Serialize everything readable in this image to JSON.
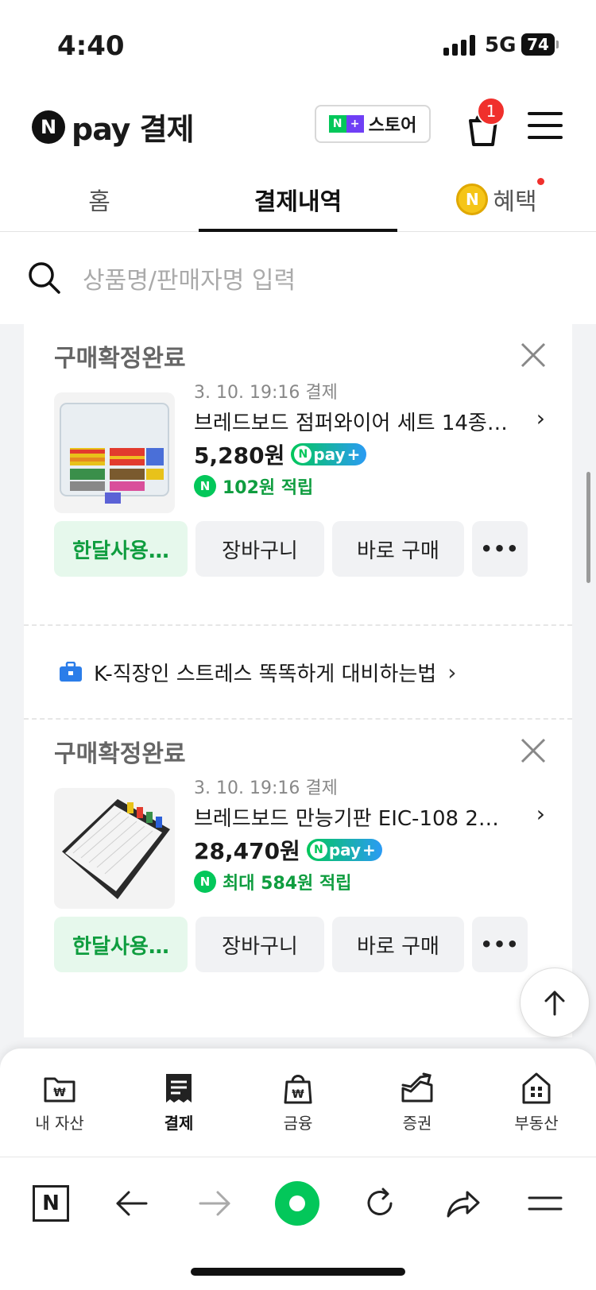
{
  "status_bar": {
    "time": "4:40",
    "network": "5G",
    "battery": "74"
  },
  "header": {
    "logo_letter": "N",
    "brand": "pay 결제",
    "store_button": {
      "np_left": "N",
      "np_right": "+",
      "label": "스토어"
    },
    "cart_badge": "1"
  },
  "tabs": [
    {
      "label": "홈"
    },
    {
      "label": "결제내역"
    },
    {
      "label": "혜택",
      "coin": "N"
    }
  ],
  "search": {
    "placeholder": "상품명/판매자명 입력"
  },
  "orders": [
    {
      "status": "구매확정완료",
      "meta": "3. 10. 19:16 결제",
      "title": "브레드보드 점퍼와이어 세트 14종 …",
      "price": "5,280원",
      "npay_badge": "pay",
      "reward": "102원 적립",
      "reward_icon": "N",
      "actions": {
        "primary": "한달사용…",
        "cart": "장바구니",
        "buy": "바로 구매",
        "more": "•••"
      }
    },
    {
      "status": "구매확정완료",
      "meta": "3. 10. 19:16 결제",
      "title": "브레드보드 만능기판 EIC-108 21…",
      "price": "28,470원",
      "npay_badge": "pay",
      "reward": "최대 584원 적립",
      "reward_icon": "N",
      "actions": {
        "primary": "한달사용…",
        "cart": "장바구니",
        "buy": "바로 구매",
        "more": "•••"
      }
    }
  ],
  "banner": {
    "text": "K-직장인 스트레스 똑똑하게 대비하는법",
    "chevron": "›"
  },
  "bottom_nav": [
    {
      "label": "내 자산"
    },
    {
      "label": "결제"
    },
    {
      "label": "금융"
    },
    {
      "label": "증권"
    },
    {
      "label": "부동산"
    }
  ],
  "toolbar": {
    "home_letter": "N"
  },
  "colors": {
    "naver_green": "#03c75a",
    "reward_green": "#0f9d3f",
    "badge_red": "#f0302c"
  }
}
